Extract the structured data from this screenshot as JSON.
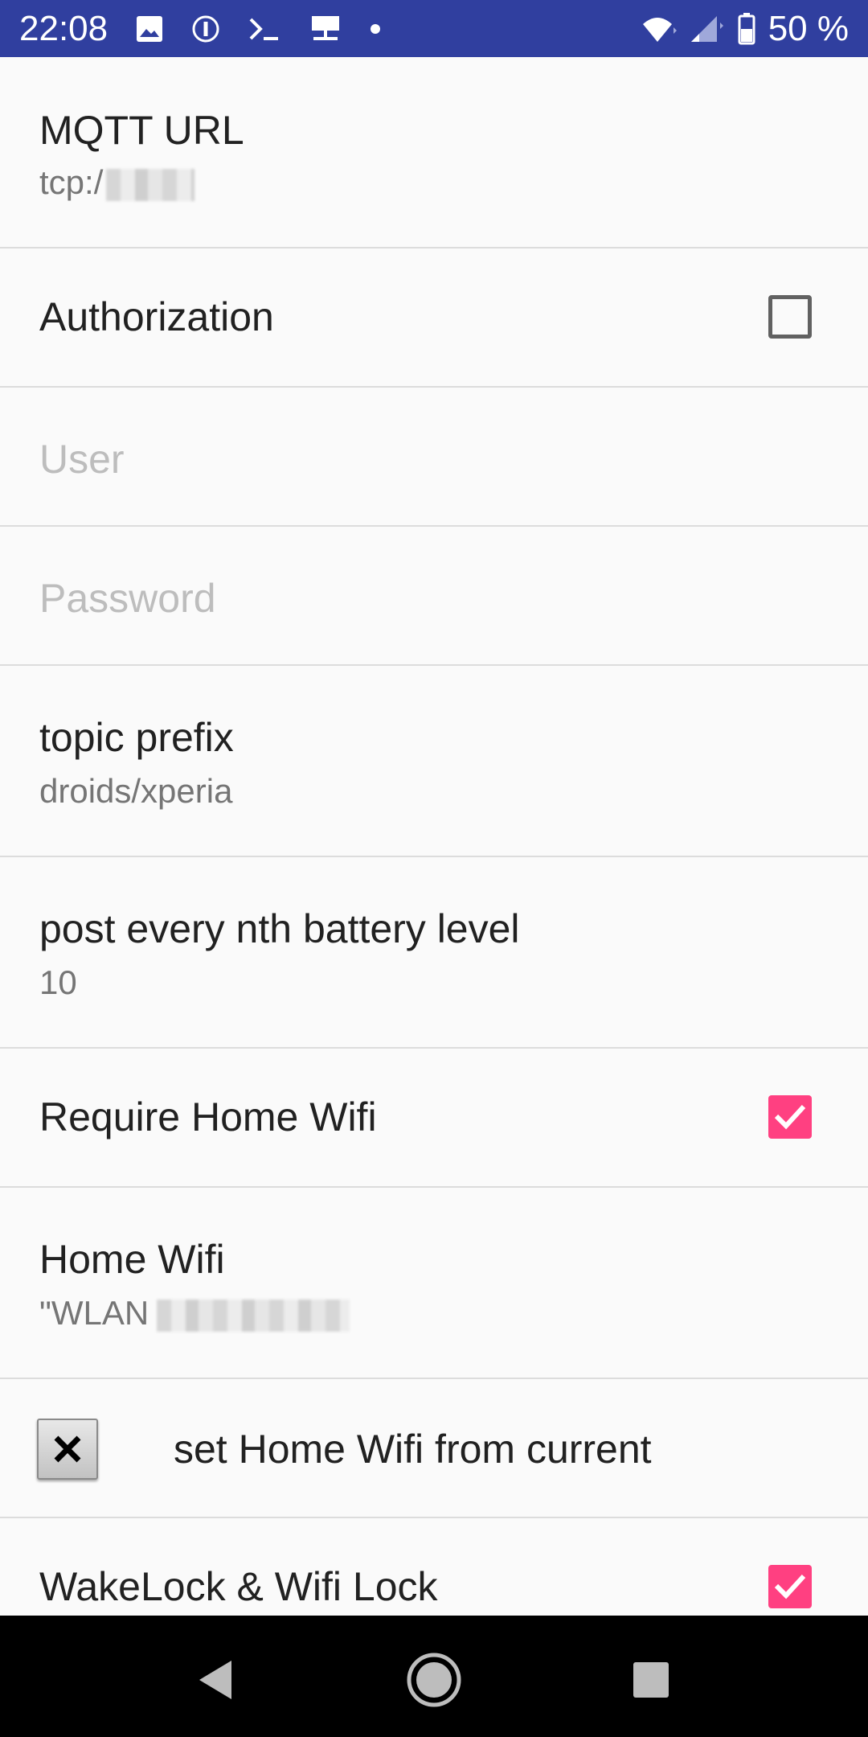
{
  "status_bar": {
    "time": "22:08",
    "battery_text": "50 %",
    "left_icons": [
      "image-icon",
      "info-circle-icon",
      "terminal-icon",
      "network-icon",
      "dot-icon"
    ],
    "right_icons": [
      "wifi-icon",
      "cell-signal-icon",
      "battery-icon"
    ],
    "bg_color": "#303f9f"
  },
  "preferences": {
    "mqtt_url": {
      "title": "MQTT URL",
      "summary": "tcp:/"
    },
    "authorization": {
      "title": "Authorization",
      "checked": false
    },
    "user": {
      "title": "User"
    },
    "password": {
      "title": "Password"
    },
    "topic_prefix": {
      "title": "topic prefix",
      "summary": "droids/xperia"
    },
    "battery_level": {
      "title": "post every nth battery level",
      "summary": "10"
    },
    "require_home_wifi": {
      "title": "Require Home Wifi",
      "checked": true
    },
    "home_wifi": {
      "title": "Home Wifi",
      "summary": "\"WLAN"
    },
    "set_home_wifi": {
      "label": "set Home Wifi from current",
      "button_icon": "close-x-icon"
    },
    "wakelock": {
      "title": "WakeLock & Wifi Lock",
      "checked": true
    }
  },
  "colors": {
    "accent": "#ff4081",
    "primary_dark": "#303f9f"
  },
  "nav_bar": {
    "buttons": [
      "back-icon",
      "home-icon",
      "recents-icon"
    ]
  }
}
